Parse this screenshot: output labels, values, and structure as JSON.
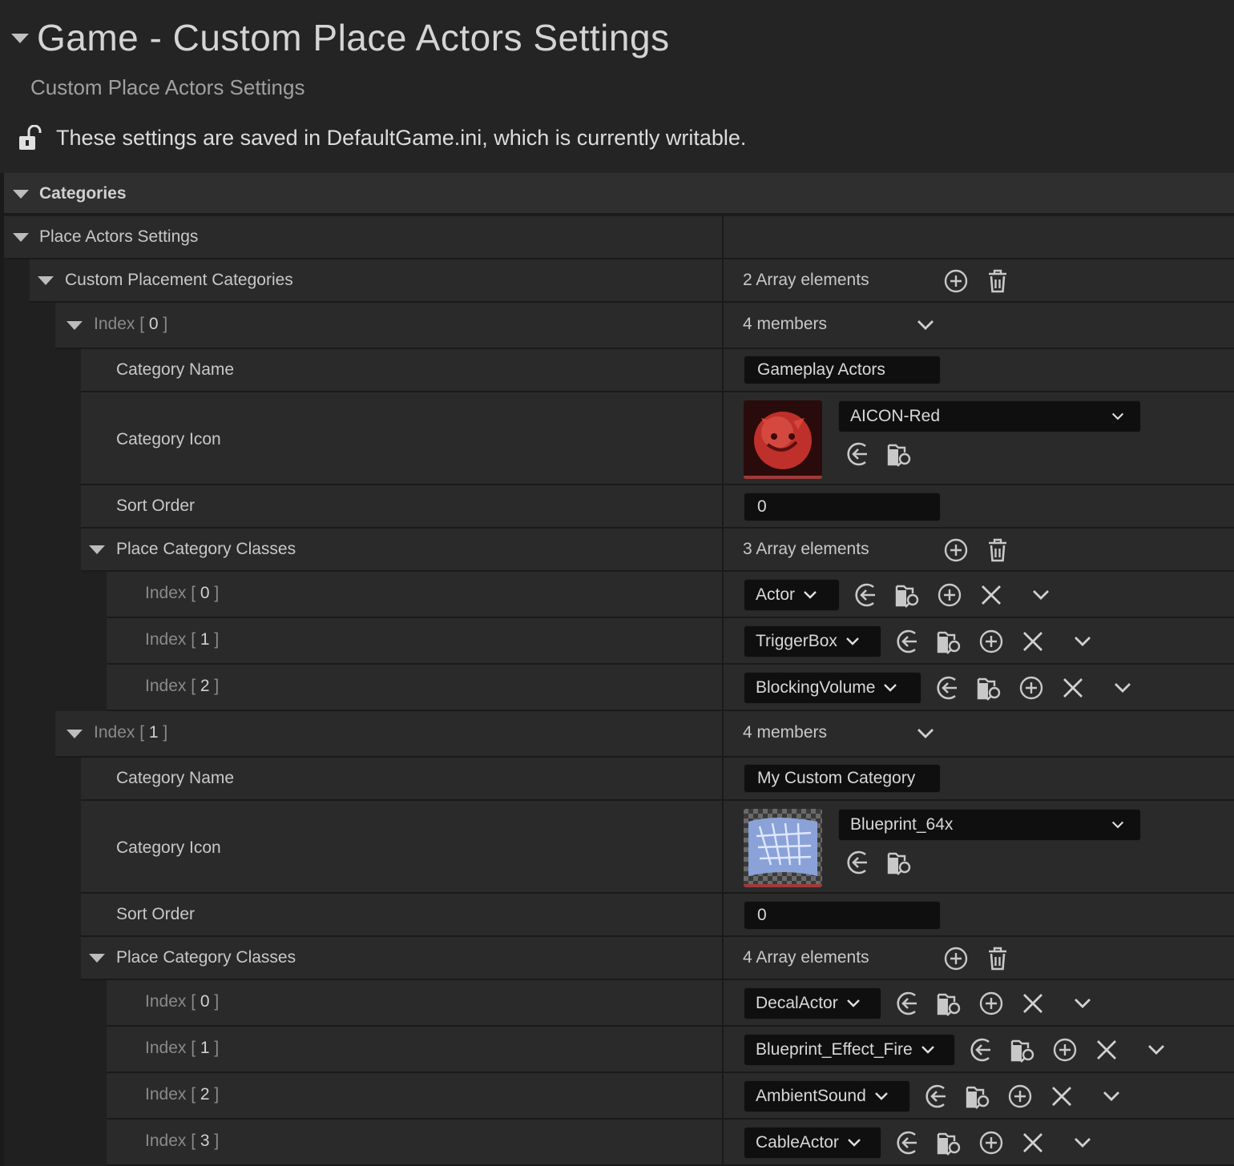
{
  "header": {
    "title": "Game - Custom Place Actors Settings",
    "subtitle": "Custom Place Actors Settings",
    "note": "These settings are saved in DefaultGame.ini, which is currently writable."
  },
  "categories_label": "Categories",
  "section_label": "Place Actors Settings",
  "custom_placement": {
    "label": "Custom Placement Categories",
    "count": "2 Array elements"
  },
  "entries": [
    {
      "index_label": "Index",
      "index_num": "0",
      "members": "4 members",
      "category_name_label": "Category Name",
      "category_name": "Gameplay Actors",
      "category_icon_label": "Category Icon",
      "category_icon": "AICON-Red",
      "sort_order_label": "Sort Order",
      "sort_order": "0",
      "classes_label": "Place Category Classes",
      "classes_count": "3 Array elements",
      "classes": [
        {
          "index": "0",
          "value": "Actor"
        },
        {
          "index": "1",
          "value": "TriggerBox"
        },
        {
          "index": "2",
          "value": "BlockingVolume"
        }
      ]
    },
    {
      "index_label": "Index",
      "index_num": "1",
      "members": "4 members",
      "category_name_label": "Category Name",
      "category_name": "My Custom Category",
      "category_icon_label": "Category Icon",
      "category_icon": "Blueprint_64x",
      "sort_order_label": "Sort Order",
      "sort_order": "0",
      "classes_label": "Place Category Classes",
      "classes_count": "4 Array elements",
      "classes": [
        {
          "index": "0",
          "value": "DecalActor"
        },
        {
          "index": "1",
          "value": "Blueprint_Effect_Fire"
        },
        {
          "index": "2",
          "value": "AmbientSound"
        },
        {
          "index": "3",
          "value": "CableActor"
        }
      ]
    }
  ],
  "icons": {
    "lock": "unlock-icon",
    "add": "add-circle-icon",
    "delete": "trash-icon",
    "use_selected": "use-selected-arrow-icon",
    "browse": "browse-folder-icon",
    "insert": "insert-circle-icon",
    "remove": "close-x-icon",
    "expand": "chevron-down-icon"
  },
  "colors": {
    "background": "#1a1a1a",
    "row": "#2a2a2a",
    "field": "#0f0f0f",
    "text": "#c8c8c8",
    "accent_red": "#a03a3a"
  }
}
